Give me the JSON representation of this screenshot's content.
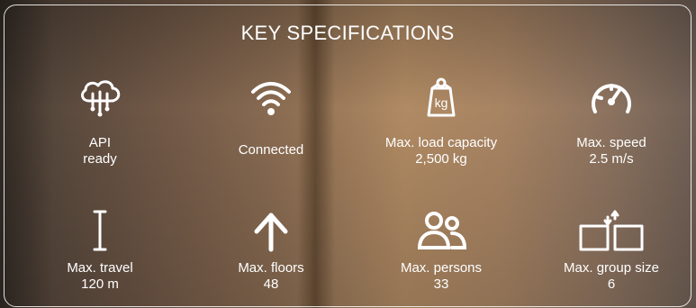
{
  "title": "KEY SPECIFICATIONS",
  "specs": [
    {
      "icon": "cloud-network-icon",
      "line1": "API",
      "line2": "ready"
    },
    {
      "icon": "wifi-icon",
      "line1": "Connected",
      "line2": ""
    },
    {
      "icon": "weight-kg-icon",
      "icon_text": "kg",
      "line1": "Max. load capacity",
      "line2": "2,500 kg"
    },
    {
      "icon": "speedometer-icon",
      "line1": "Max. speed",
      "line2": "2.5 m/s"
    },
    {
      "icon": "travel-height-icon",
      "line1": "Max. travel",
      "line2": "120 m"
    },
    {
      "icon": "up-arrow-icon",
      "line1": "Max. floors",
      "line2": "48"
    },
    {
      "icon": "persons-icon",
      "line1": "Max. persons",
      "line2": "33"
    },
    {
      "icon": "group-cars-icon",
      "line1": "Max. group size",
      "line2": "6"
    }
  ],
  "colors": {
    "text": "#ffffff",
    "border": "#ffffff"
  }
}
